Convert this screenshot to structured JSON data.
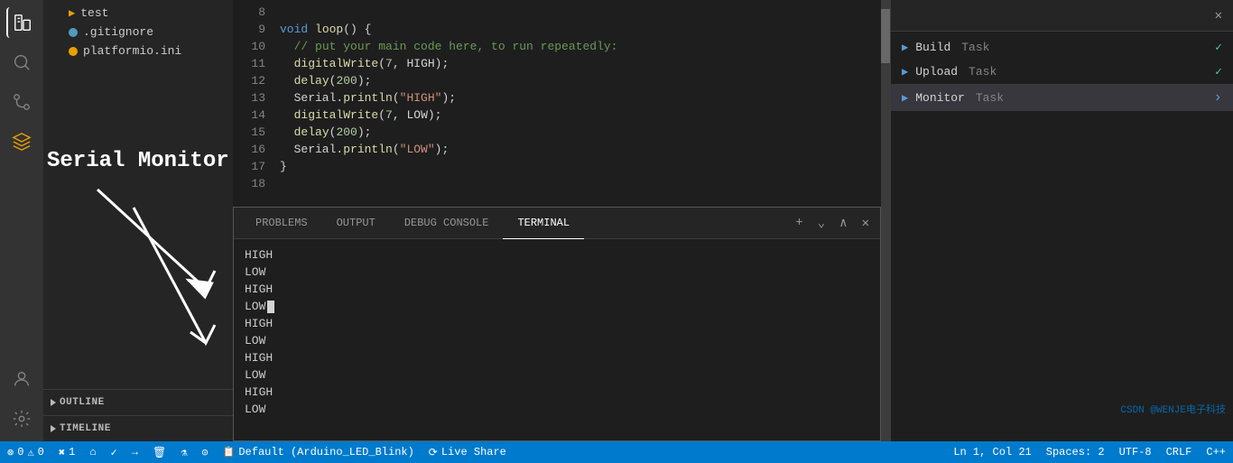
{
  "activityBar": {
    "icons": [
      "files",
      "search",
      "source-control",
      "extensions"
    ]
  },
  "sidebar": {
    "files": [
      {
        "name": "test",
        "type": "folder",
        "color": "none"
      },
      {
        "name": ".gitignore",
        "type": "file",
        "color": "none",
        "dot": "blue"
      },
      {
        "name": "platformio.ini",
        "type": "file",
        "color": "orange",
        "dot": "orange"
      }
    ],
    "sections": [
      {
        "label": "OUTLINE",
        "expanded": false
      },
      {
        "label": "TIMELINE",
        "expanded": false
      }
    ]
  },
  "codeEditor": {
    "lines": [
      {
        "num": "8",
        "code": ""
      },
      {
        "num": "9",
        "code": "void loop() {"
      },
      {
        "num": "10",
        "code": "  // put your main code here, to run repeatedly:"
      },
      {
        "num": "11",
        "code": "  digitalWrite(7, HIGH);"
      },
      {
        "num": "12",
        "code": "  delay(200);"
      },
      {
        "num": "13",
        "code": "  Serial.println(\"HIGH\");"
      },
      {
        "num": "14",
        "code": "  digitalWrite(7, LOW);"
      },
      {
        "num": "15",
        "code": "  delay(200);"
      },
      {
        "num": "16",
        "code": "  Serial.println(\"LOW\");"
      },
      {
        "num": "17",
        "code": "}"
      },
      {
        "num": "18",
        "code": ""
      }
    ]
  },
  "panel": {
    "tabs": [
      "PROBLEMS",
      "OUTPUT",
      "DEBUG CONSOLE",
      "TERMINAL"
    ],
    "activeTab": "TERMINAL",
    "terminalLines": [
      "HIGH",
      "LOW",
      "HIGH",
      "LOW",
      "HIGH",
      "LOW",
      "HIGH",
      "LOW",
      "HIGH",
      "LOW"
    ]
  },
  "rightPanel": {
    "tasks": [
      {
        "name": "Build",
        "type": "Task",
        "status": "check"
      },
      {
        "name": "Upload",
        "type": "Task",
        "status": "check"
      },
      {
        "name": "Monitor",
        "type": "Task",
        "status": "arrow",
        "active": true
      }
    ]
  },
  "annotations": {
    "serialMonitor": "Serial Monitor"
  },
  "statusBar": {
    "left": [
      {
        "icon": "⚠",
        "label": "0"
      },
      {
        "icon": "✖",
        "label": "1"
      },
      {
        "icon": "⌂"
      },
      {
        "icon": "✓"
      },
      {
        "icon": "→"
      },
      {
        "icon": "🗑"
      },
      {
        "icon": "🔬"
      },
      {
        "icon": "⊙"
      }
    ],
    "middle": "Default (Arduino_LED_Blink)",
    "liveShare": "Live Share",
    "right": [
      "Ln 1, Col 21",
      "Spaces: 2",
      "UTF-8",
      "CRLF",
      "C++"
    ]
  },
  "watermark": "CSDN @WENJE电子科技"
}
